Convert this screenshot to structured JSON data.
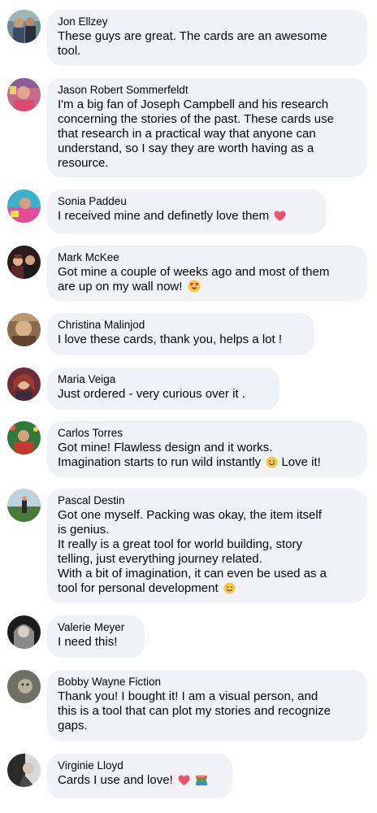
{
  "comments": [
    {
      "author": "Jon Ellzey",
      "lines": [
        "These guys are great. The cards are an awesome",
        "tool."
      ]
    },
    {
      "author": "Jason Robert Sommerfeldt",
      "lines": [
        "I'm a big fan of Joseph Campbell and his research",
        "concerning the stories of the past. These cards use",
        "that research in a practical way that anyone can",
        "understand, so I say they are worth having as a",
        "resource."
      ]
    },
    {
      "author": "Sonia Paddeu",
      "lines": [
        "I received mine and definetly love them"
      ],
      "emoji": "heart"
    },
    {
      "author": "Mark McKee",
      "lines": [
        "Got mine a couple of weeks ago and most of them",
        "are up on my wall now!"
      ],
      "emoji": "heart-eyes"
    },
    {
      "author": "Christina Malinjod",
      "lines": [
        "I love these cards, thank you, helps a lot !"
      ]
    },
    {
      "author": "Maria Veiga",
      "lines": [
        "Just ordered - very curious over it ."
      ]
    },
    {
      "author": "Carlos Torres",
      "lines": [
        "Got mine! Flawless design and it works.",
        "Imagination starts to run wild instantly",
        "Love it!"
      ],
      "emoji": "smile"
    },
    {
      "author": "Pascal Destin",
      "lines": [
        "Got one myself. Packing was okay, the item itself",
        "is genius.",
        "It really is a great tool for world building, story",
        "telling, just everything journey related.",
        "With a bit of imagination, it can even be used as a",
        "tool for personal development"
      ],
      "emoji": "wink"
    },
    {
      "author": "Valerie Meyer",
      "lines": [
        "I need this!"
      ]
    },
    {
      "author": "Bobby Wayne Fiction",
      "lines": [
        "Thank you! I bought it! I am a visual person, and",
        "this is a tool that can plot my stories and recognize",
        "gaps."
      ]
    },
    {
      "author": "Virginie Lloyd",
      "lines": [
        "Cards I use and love!"
      ],
      "emoji": "heart-books"
    }
  ],
  "colors": {
    "bubble": "#f0f2f5",
    "text": "#050505",
    "heart": "#f0506e",
    "emoji_face": "#f7c948"
  }
}
